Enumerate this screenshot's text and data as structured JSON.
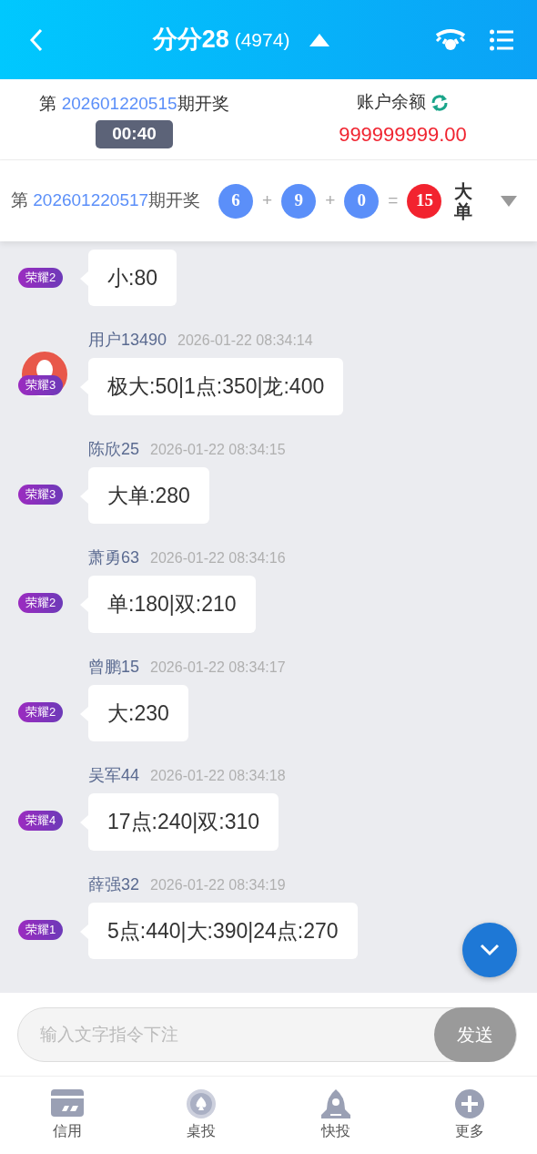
{
  "header": {
    "title": "分分28",
    "count": "(4974)"
  },
  "current": {
    "prefix": "第",
    "issue": "202601220515",
    "suffix": "期开奖",
    "timer": "00:40",
    "balance_label": "账户余额",
    "balance": "999999999.00"
  },
  "last_draw": {
    "prefix": "第",
    "issue": "202601220517",
    "suffix": "期开奖",
    "items": [
      {
        "kind": "ball",
        "text": "6",
        "color": "#5b8ff9"
      },
      {
        "kind": "op",
        "text": "+"
      },
      {
        "kind": "ball",
        "text": "9",
        "color": "#5b8ff9"
      },
      {
        "kind": "op",
        "text": "+"
      },
      {
        "kind": "ball",
        "text": "0",
        "color": "#5b8ff9"
      },
      {
        "kind": "op",
        "text": "="
      },
      {
        "kind": "ball",
        "text": "15",
        "color": "#f2232f"
      }
    ],
    "result": "大单"
  },
  "messages": [
    {
      "badge": "荣耀2",
      "avatar": false,
      "text": "小:80"
    },
    {
      "name": "用户13490",
      "time": "2026-01-22 08:34:14",
      "badge": "荣耀3",
      "avatar": true,
      "text": "极大:50|1点:350|龙:400"
    },
    {
      "name": "陈欣25",
      "time": "2026-01-22 08:34:15",
      "badge": "荣耀3",
      "avatar": false,
      "text": "大单:280"
    },
    {
      "name": "萧勇63",
      "time": "2026-01-22 08:34:16",
      "badge": "荣耀2",
      "avatar": false,
      "text": "单:180|双:210"
    },
    {
      "name": "曾鹏15",
      "time": "2026-01-22 08:34:17",
      "badge": "荣耀2",
      "avatar": false,
      "text": "大:230"
    },
    {
      "name": "吴军44",
      "time": "2026-01-22 08:34:18",
      "badge": "荣耀4",
      "avatar": false,
      "text": "17点:240|双:310"
    },
    {
      "name": "薛强32",
      "time": "2026-01-22 08:34:19",
      "badge": "荣耀1",
      "avatar": false,
      "text": "5点:440|大:390|24点:270"
    }
  ],
  "input": {
    "placeholder": "输入文字指令下注",
    "send": "发送"
  },
  "nav": [
    {
      "kind": "card",
      "label": "信用"
    },
    {
      "kind": "spade",
      "label": "桌投"
    },
    {
      "kind": "rocket",
      "label": "快投"
    },
    {
      "kind": "plus",
      "label": "更多"
    }
  ]
}
